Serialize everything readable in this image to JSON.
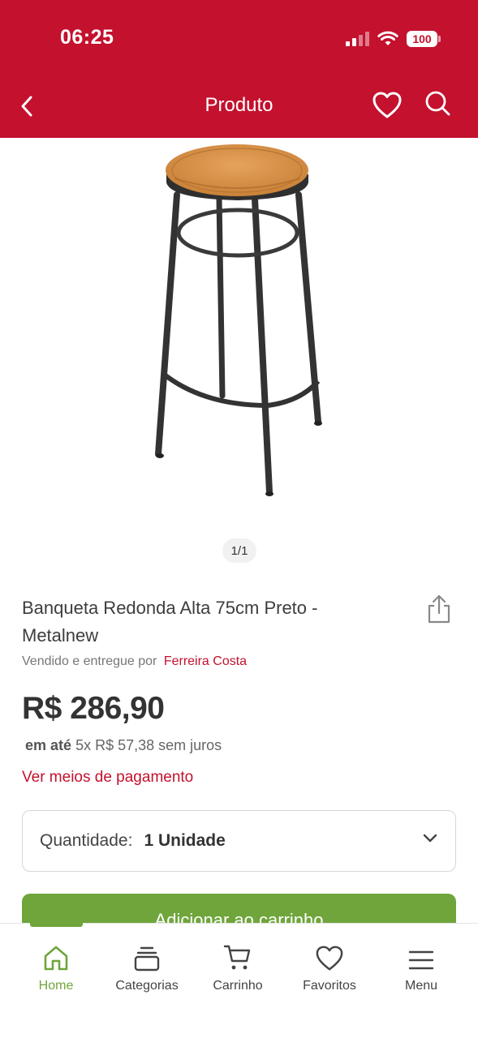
{
  "status_bar": {
    "time": "06:25",
    "battery": "100"
  },
  "nav": {
    "title": "Produto",
    "back_icon": "chevron-left-icon",
    "favorite_icon": "heart-icon",
    "search_icon": "search-icon"
  },
  "product": {
    "pager": "1/1",
    "title": "Banqueta Redonda Alta 75cm Preto - Metalnew",
    "seller_prefix": "Vendido e entregue por",
    "seller_name": "Ferreira Costa",
    "price": "R$ 286,90",
    "installments_prefix": "em até",
    "installments_text": "5x R$ 57,38 sem juros",
    "payment_link": "Ver meios de pagamento"
  },
  "quantity": {
    "label": "Quantidade:",
    "value": "1 Unidade"
  },
  "add_to_cart": "Adicionar ao carrinho",
  "bottom_nav": {
    "items": [
      {
        "label": "Home",
        "icon": "home-icon",
        "active": true
      },
      {
        "label": "Categorias",
        "icon": "categories-icon"
      },
      {
        "label": "Carrinho",
        "icon": "cart-icon"
      },
      {
        "label": "Favoritos",
        "icon": "heart-icon"
      },
      {
        "label": "Menu",
        "icon": "menu-icon"
      }
    ]
  },
  "colors": {
    "brand_red": "#c3112e",
    "accent_green": "#6fa53b"
  }
}
